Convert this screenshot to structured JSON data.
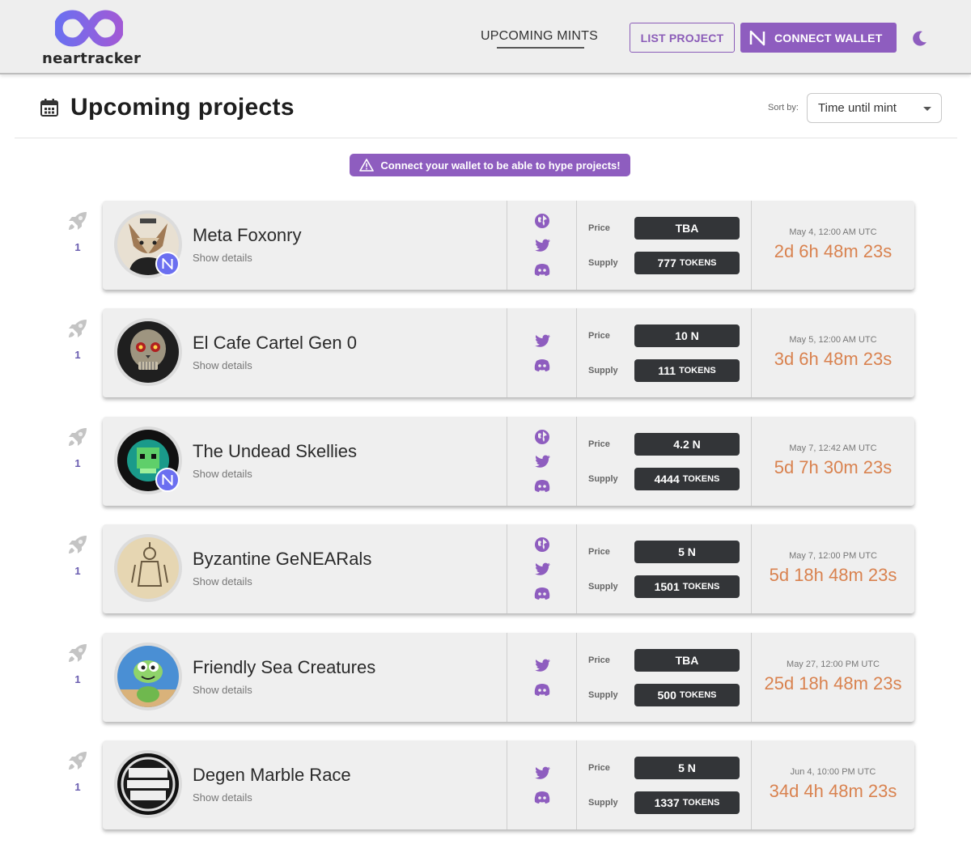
{
  "header": {
    "logo_text": "neartracker",
    "nav_upcoming": "UPCOMING MINTS",
    "list_project": "LIST PROJECT",
    "connect_wallet": "CONNECT WALLET"
  },
  "page": {
    "title": "Upcoming projects",
    "sort_label": "Sort by:",
    "sort_value": "Time until mint",
    "banner": "Connect your wallet to be able to hype projects!"
  },
  "colors": {
    "accent": "#8e5dbf",
    "countdown": "#d9824f",
    "pill": "#333538"
  },
  "labels": {
    "price": "Price",
    "supply": "Supply",
    "tokens": "TOKENS",
    "show_details": "Show details"
  },
  "projects": [
    {
      "name": "Meta Foxonry",
      "hype": "1",
      "price": "TBA",
      "supply": "777",
      "date": "May 4, 12:00 AM UTC",
      "countdown": "2d 6h 48m 23s"
    },
    {
      "name": "El Cafe Cartel Gen 0",
      "hype": "1",
      "price": "10 N",
      "supply": "111",
      "date": "May 5, 12:00 AM UTC",
      "countdown": "3d 6h 48m 23s"
    },
    {
      "name": "The Undead Skellies",
      "hype": "1",
      "price": "4.2 N",
      "supply": "4444",
      "date": "May 7, 12:42 AM UTC",
      "countdown": "5d 7h 30m 23s"
    },
    {
      "name": "Byzantine GeNEARals",
      "hype": "1",
      "price": "5 N",
      "supply": "1501",
      "date": "May 7, 12:00 PM UTC",
      "countdown": "5d 18h 48m 23s"
    },
    {
      "name": "Friendly Sea Creatures",
      "hype": "1",
      "price": "TBA",
      "supply": "500",
      "date": "May 27, 12:00 PM UTC",
      "countdown": "25d 18h 48m 23s"
    },
    {
      "name": "Degen Marble Race",
      "hype": "1",
      "price": "5 N",
      "supply": "1337",
      "date": "Jun 4, 10:00 PM UTC",
      "countdown": "34d 4h 48m 23s"
    }
  ]
}
